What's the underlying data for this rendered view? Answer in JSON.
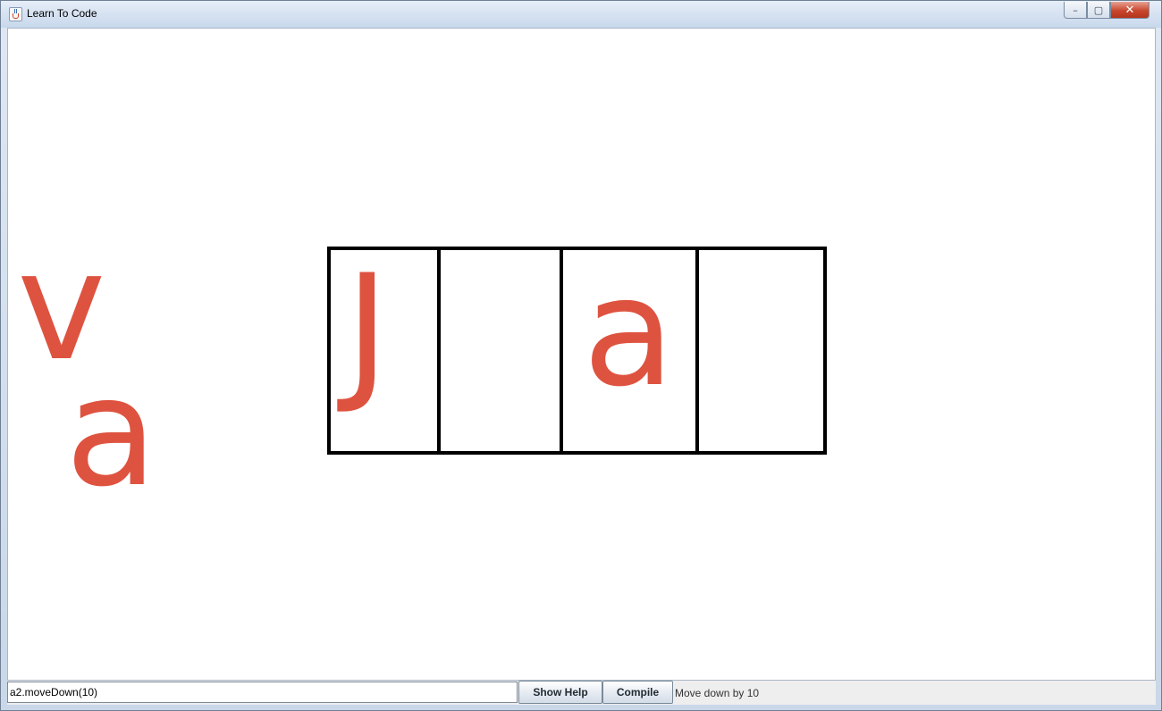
{
  "window": {
    "title": "Learn To Code",
    "controls": {
      "minimize_icon": "minimize-icon",
      "maximize_icon": "maximize-icon",
      "close_icon": "close-icon",
      "minimize_glyph": "–",
      "maximize_glyph": "▢",
      "close_glyph": "✕"
    }
  },
  "canvas": {
    "letter_color": "#de5340",
    "boxes": [
      {
        "letter": "J"
      },
      {
        "letter": ""
      },
      {
        "letter": "a"
      },
      {
        "letter": ""
      }
    ],
    "loose_letters": [
      "v",
      "a"
    ]
  },
  "command_bar": {
    "input_value": "a2.moveDown(10)",
    "show_help_label": "Show Help",
    "compile_label": "Compile",
    "status": "Move down by 10"
  }
}
